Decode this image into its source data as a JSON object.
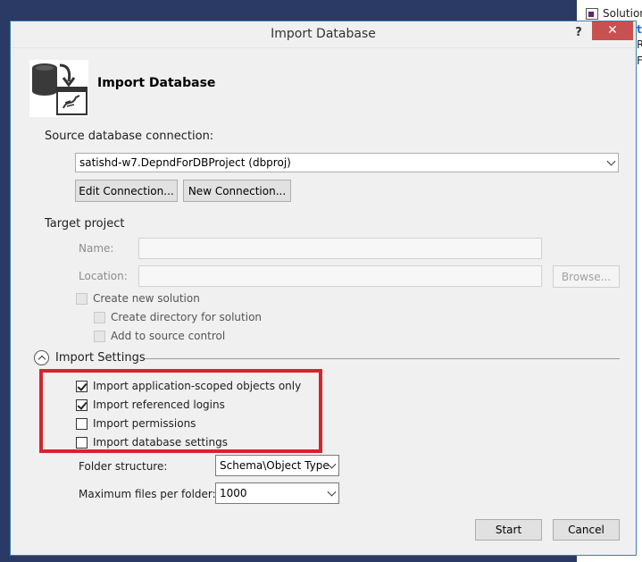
{
  "background": {
    "solution_label": "Solution",
    "frag1": "ta",
    "frag2": "R",
    "frag3": "F"
  },
  "window": {
    "title": "Import Database",
    "help": "?",
    "close": "✕"
  },
  "header": {
    "title": "Import Database",
    "icon": "database-import-icon"
  },
  "source": {
    "label": "Source database connection:",
    "selected": "satishd-w7.DepndForDBProject (dbproj)",
    "edit_button": "Edit Connection...",
    "new_button": "New Connection..."
  },
  "target": {
    "label": "Target project",
    "name_label": "Name:",
    "name_value": "",
    "location_label": "Location:",
    "location_value": "",
    "browse_button": "Browse...",
    "create_solution": "Create new solution",
    "create_directory": "Create directory for solution",
    "add_source_control": "Add to source control"
  },
  "import_settings": {
    "label": "Import Settings",
    "options": [
      {
        "label": "Import application-scoped objects only",
        "checked": true
      },
      {
        "label": "Import referenced logins",
        "checked": true
      },
      {
        "label": "Import permissions",
        "checked": false
      },
      {
        "label": "Import database settings",
        "checked": false
      }
    ],
    "folder_structure_label": "Folder structure:",
    "folder_structure_value": "Schema\\Object Type",
    "max_files_label": "Maximum files per folder:",
    "max_files_value": "1000"
  },
  "footer": {
    "start_button": "Start",
    "cancel_button": "Cancel"
  },
  "colors": {
    "highlight": "#d4252e",
    "close_button": "#c75050",
    "dialog_border": "#3c7fb1"
  }
}
